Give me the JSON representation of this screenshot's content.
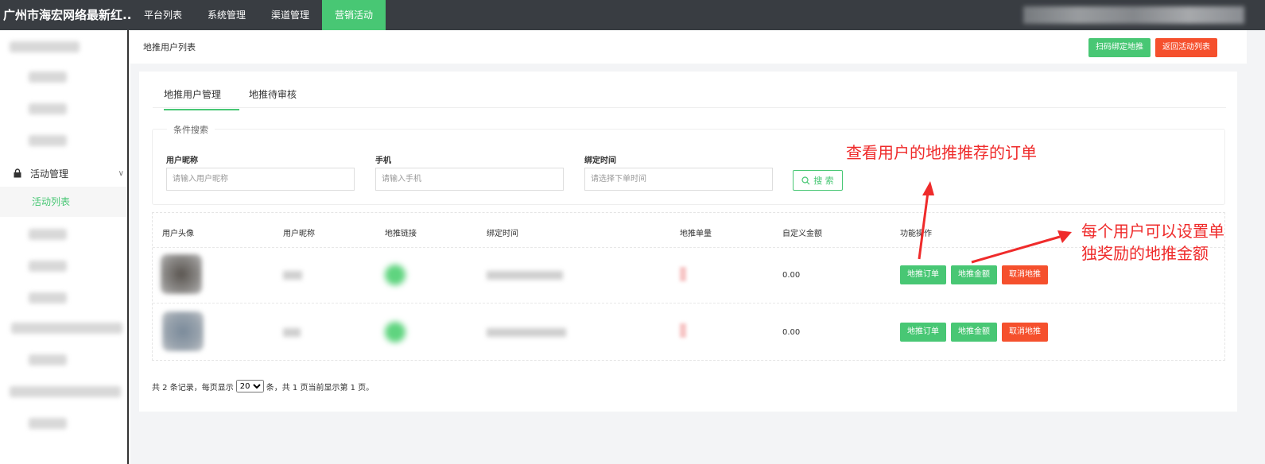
{
  "topbar": {
    "brand": "广州市海宏网络最新红...",
    "nav": [
      "平台列表",
      "系统管理",
      "渠道管理",
      "营销活动"
    ],
    "active_index": 3
  },
  "sidebar": {
    "group_label": "活动管理",
    "active_item": "活动列表"
  },
  "page": {
    "title": "地推用户列表",
    "buttons": {
      "scan_bind": "扫码绑定地推",
      "back": "返回活动列表"
    }
  },
  "tabs": [
    "地推用户管理",
    "地推待审核"
  ],
  "search": {
    "legend": "条件搜索",
    "fields": [
      {
        "label": "用户昵称",
        "placeholder": "请输入用户昵称"
      },
      {
        "label": "手机",
        "placeholder": "请输入手机"
      },
      {
        "label": "绑定时间",
        "placeholder": "请选择下单时间"
      }
    ],
    "button": "搜 索"
  },
  "table": {
    "headers": [
      "用户头像",
      "用户昵称",
      "地推链接",
      "绑定时间",
      "地推单量",
      "自定义金额",
      "功能操作"
    ],
    "rows": [
      {
        "custom_amount": "0.00"
      },
      {
        "custom_amount": "0.00"
      }
    ],
    "actions": {
      "orders": "地推订单",
      "amount": "地推金额",
      "cancel": "取消地推"
    }
  },
  "pager": {
    "prefix": "共 2 条记录，每页显示",
    "page_size": "20",
    "suffix": "条，共 1 页当前显示第 1 页。"
  },
  "annotations": {
    "orders_note": "查看用户的地推推荐的订单",
    "amount_note_line1": "每个用户可以设置单",
    "amount_note_line2": "独奖励的地推金额"
  },
  "colors": {
    "accent": "#48c774",
    "danger": "#f5502d",
    "topbar": "#393d42",
    "annotation": "#ef2b2b"
  }
}
